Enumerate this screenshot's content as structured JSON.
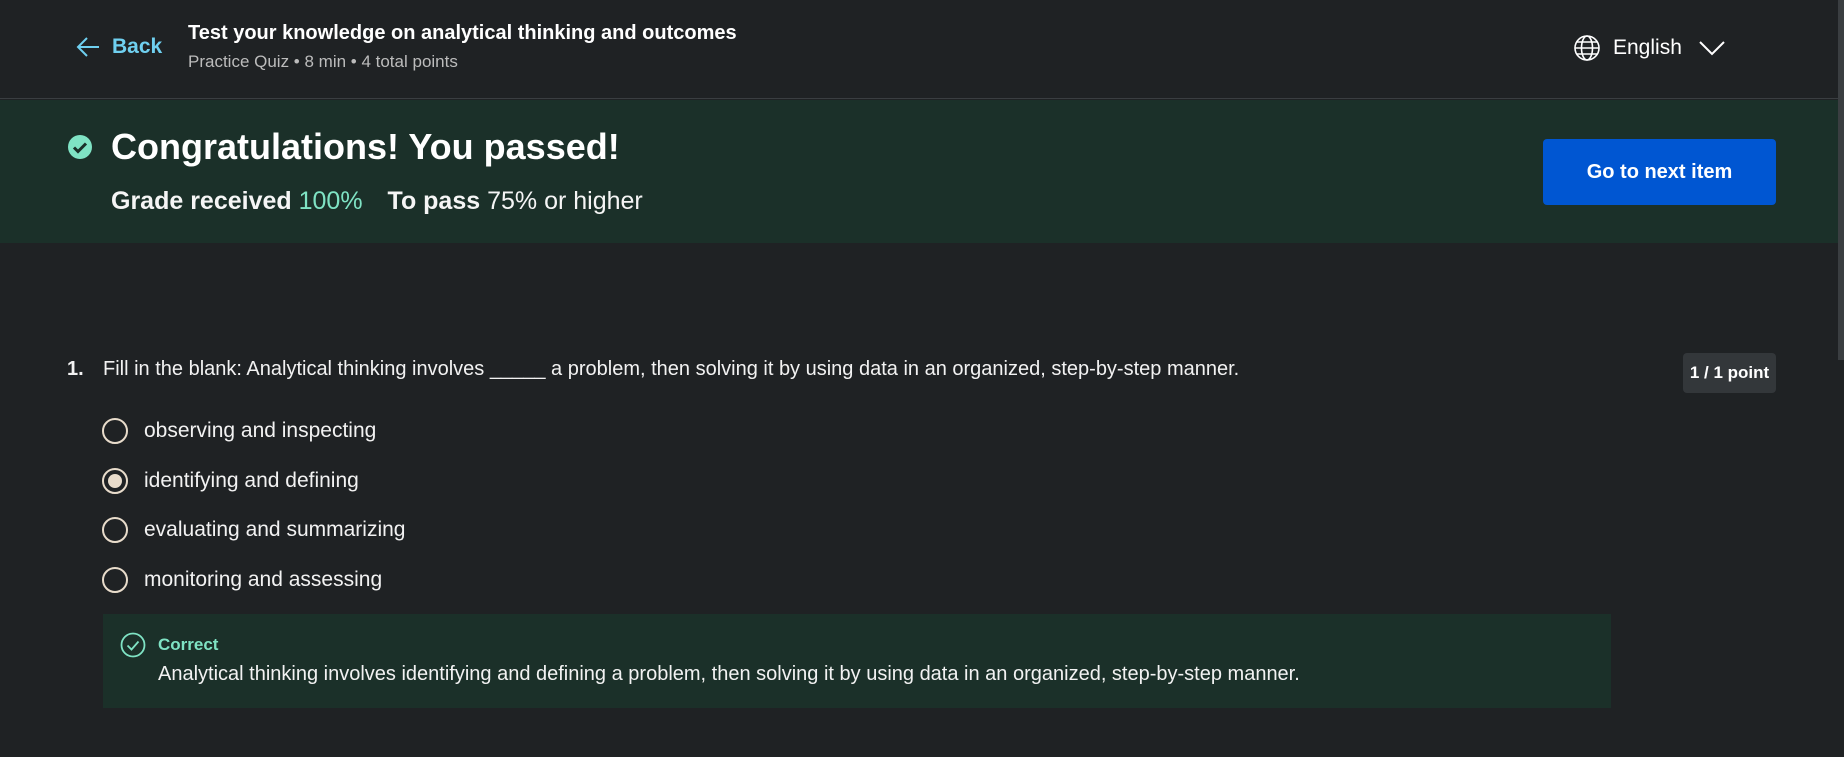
{
  "header": {
    "back_label": "Back",
    "title": "Test your knowledge on analytical thinking and outcomes",
    "meta": "Practice Quiz • 8 min • 4 total points",
    "language": "English"
  },
  "banner": {
    "heading": "Congratulations! You passed!",
    "grade_label": "Grade received",
    "grade_value": "100%",
    "pass_label": "To pass",
    "pass_value": "75% or higher",
    "next_button": "Go to next item"
  },
  "question": {
    "number": "1.",
    "text": "Fill in the blank: Analytical thinking involves _____ a problem, then solving it by using data in an organized, step-by-step manner.",
    "points": "1 / 1 point",
    "options": [
      {
        "label": "observing and inspecting",
        "selected": false
      },
      {
        "label": "identifying and defining",
        "selected": true
      },
      {
        "label": "evaluating and summarizing",
        "selected": false
      },
      {
        "label": "monitoring and assessing",
        "selected": false
      }
    ],
    "feedback": {
      "status": "Correct",
      "text": "Analytical thinking involves identifying and defining a problem, then solving it by using data in an organized, step-by-step manner."
    }
  },
  "colors": {
    "accent_link": "#6fd0f0",
    "success": "#7fe3c4",
    "primary_button": "#0056d2",
    "banner_bg": "#1b3029",
    "page_bg": "#1f2224"
  },
  "icons": [
    "arrow-left-icon",
    "globe-icon",
    "chevron-down-icon",
    "check-circle-icon"
  ]
}
